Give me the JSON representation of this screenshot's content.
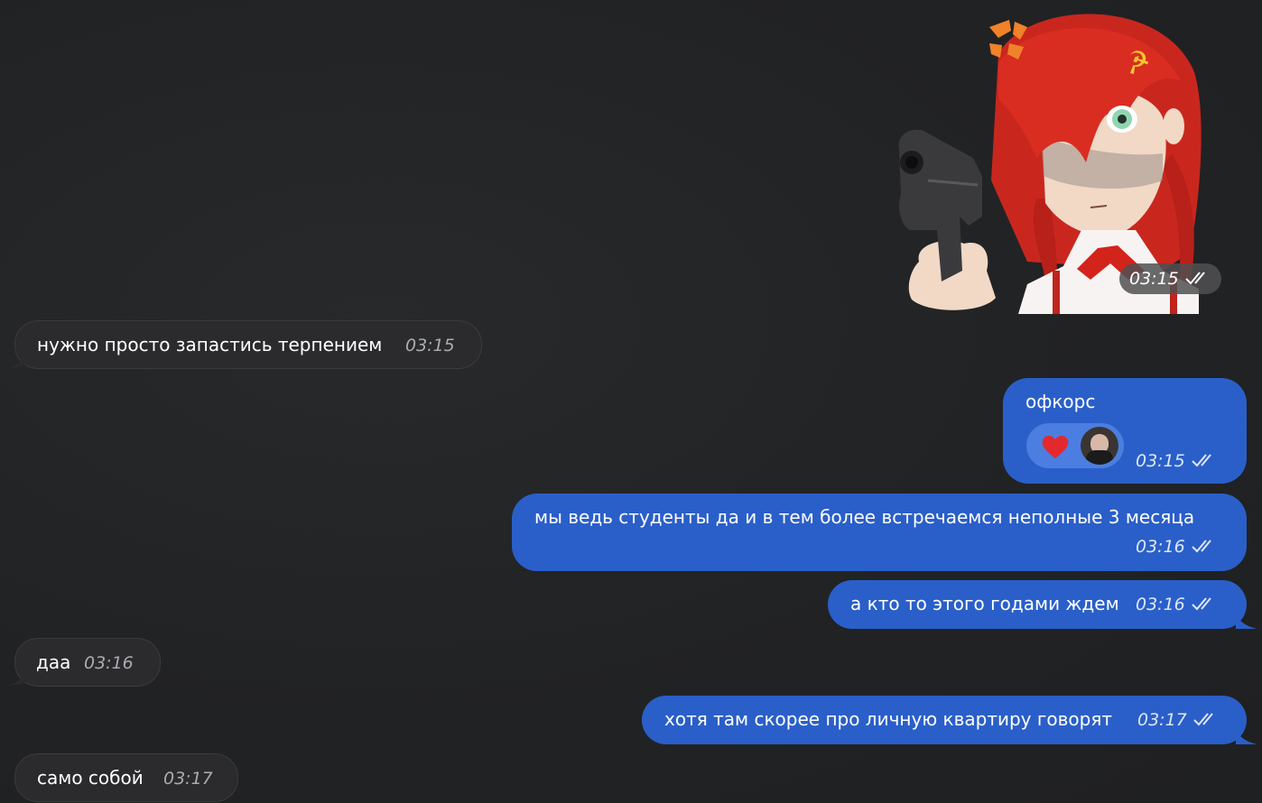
{
  "chat": {
    "sticker": {
      "time": "03:15",
      "emblem": "☭",
      "description_icon": "angry-girl-sticker-icon"
    },
    "messages": [
      {
        "direction": "incoming",
        "text": "нужно просто запастись терпением",
        "time": "03:15"
      },
      {
        "direction": "outgoing",
        "text": "офкорс",
        "time": "03:15",
        "reaction": {
          "emoji": "❤️",
          "avatar": "user-avatar"
        }
      },
      {
        "direction": "outgoing",
        "text": "мы ведь студенты да и в тем более встречаемся неполные 3 месяца",
        "time": "03:16"
      },
      {
        "direction": "outgoing",
        "text": "а кто то этого годами ждем",
        "time": "03:16"
      },
      {
        "direction": "incoming",
        "text": "даа",
        "time": "03:16"
      },
      {
        "direction": "outgoing",
        "text": "хотя там скорее про личную квартиру говорят",
        "time": "03:17"
      },
      {
        "direction": "incoming",
        "text": "само собой",
        "time": "03:17"
      }
    ]
  },
  "colors": {
    "background": "#222325",
    "incoming_bubble": "#2b2b2d",
    "outgoing_bubble": "#2a5fc9",
    "reaction_pill": "#4b7ee0"
  }
}
